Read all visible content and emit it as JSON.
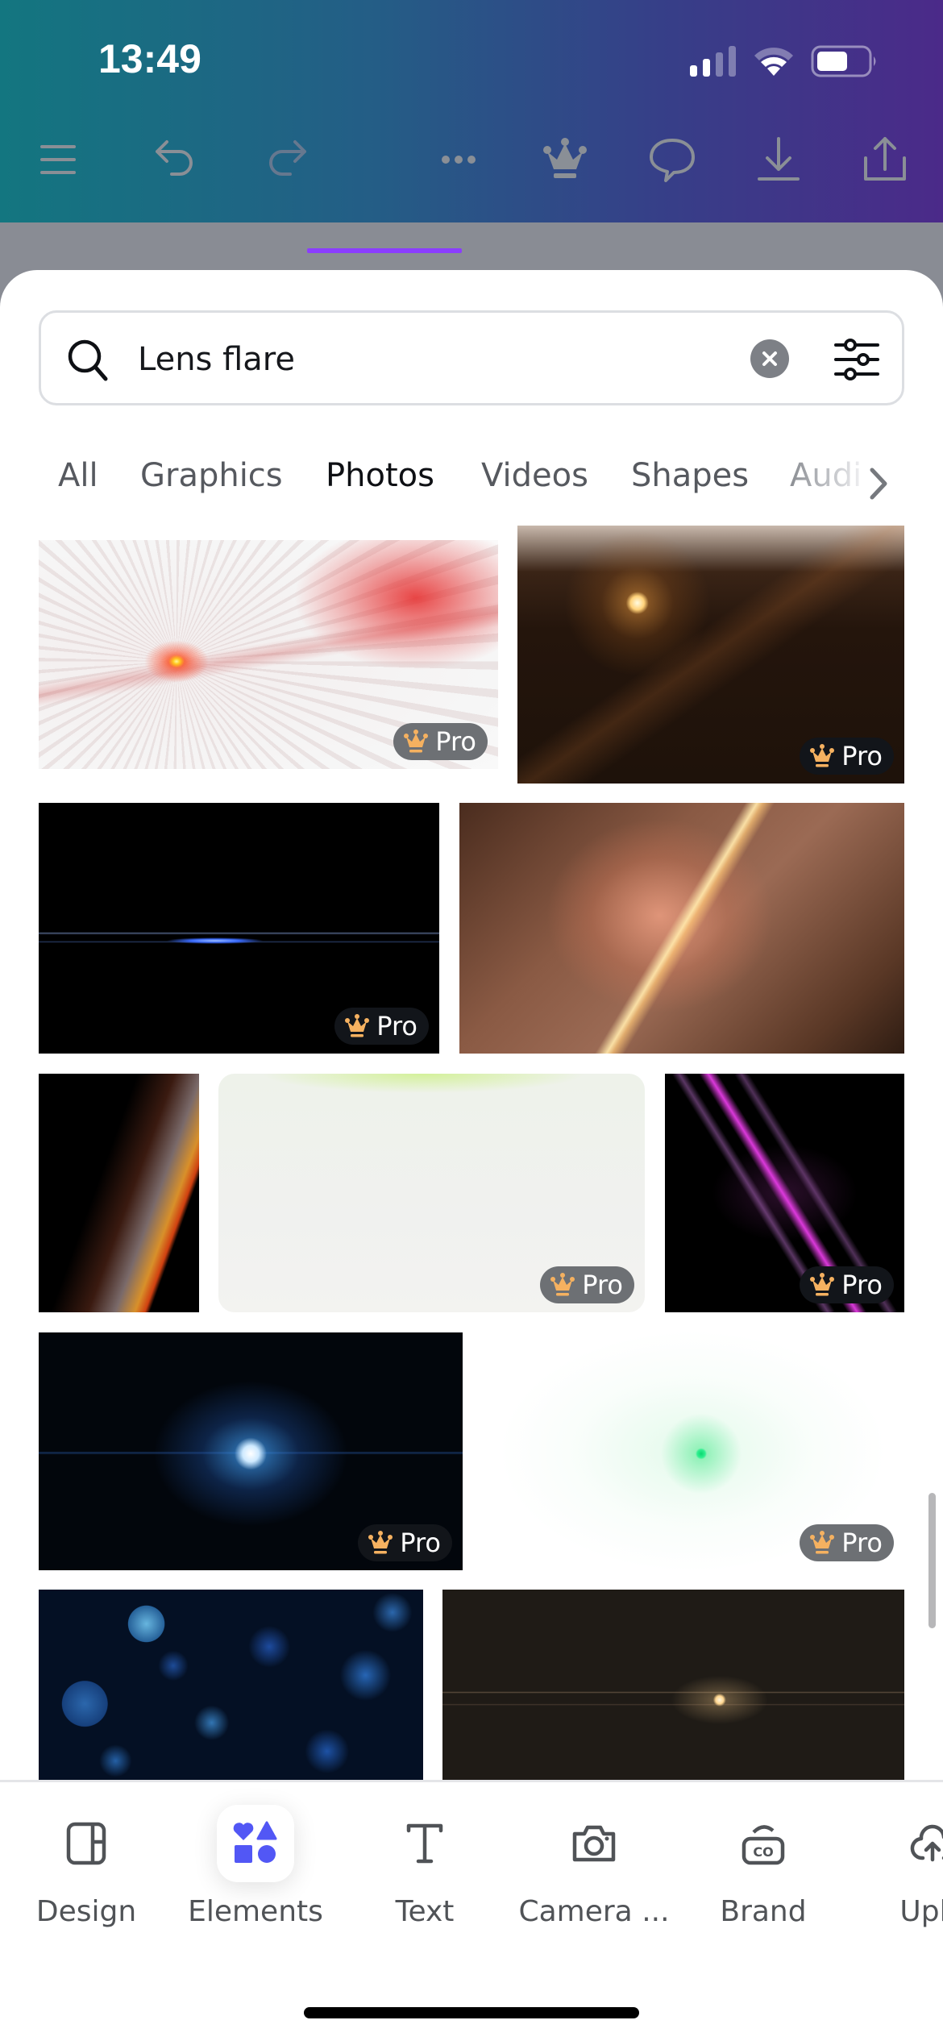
{
  "status_bar": {
    "time": "13:49",
    "icons": [
      "cellular-signal-icon",
      "wifi-icon",
      "battery-icon"
    ]
  },
  "toolbar": {
    "icons": [
      "menu-icon",
      "undo-icon",
      "redo-icon",
      "more-icon",
      "crown-icon",
      "comment-icon",
      "download-icon",
      "share-icon"
    ]
  },
  "search": {
    "value": "Lens flare",
    "icon": "search-icon",
    "clear_icon": "clear-icon",
    "filter_icon": "filter-sliders-icon"
  },
  "tabs": {
    "items": [
      {
        "label": "All",
        "active": false
      },
      {
        "label": "Graphics",
        "active": false
      },
      {
        "label": "Photos",
        "active": true
      },
      {
        "label": "Videos",
        "active": false
      },
      {
        "label": "Shapes",
        "active": false
      },
      {
        "label": "Audi",
        "active": false
      }
    ],
    "more_icon": "chevron-right-icon",
    "accent_color": "#8b3dff"
  },
  "results": {
    "badge_label": "Pro",
    "badge_icon": "crown-icon",
    "badge_icon_color": "#f5b160",
    "items": [
      {
        "description": "Red starburst lens flare on white",
        "pro": true,
        "badge_style": "light"
      },
      {
        "description": "Golden sun star lens flare on dark brown",
        "pro": true,
        "badge_style": "dark"
      },
      {
        "description": "Blue horizontal anamorphic streak on black",
        "pro": true,
        "badge_style": "dark"
      },
      {
        "description": "Warm peach diagonal light leak",
        "pro": false,
        "badge_style": ""
      },
      {
        "description": "Rainbow prism edge on black",
        "pro": false,
        "badge_style": ""
      },
      {
        "description": "Pale green-white gradient glow",
        "pro": true,
        "badge_style": "light"
      },
      {
        "description": "Purple diagonal light streaks on black",
        "pro": true,
        "badge_style": "dark"
      },
      {
        "description": "Blue glowing light orb on black",
        "pro": true,
        "badge_style": "dark"
      },
      {
        "description": "Green lens flare dot on white",
        "pro": true,
        "badge_style": "light"
      },
      {
        "description": "Blue bokeh circles",
        "pro": false,
        "badge_style": ""
      },
      {
        "description": "Small warm flare on dark background",
        "pro": false,
        "badge_style": ""
      }
    ]
  },
  "bottom_nav": {
    "items": [
      {
        "label": "Design",
        "icon": "design-layout-icon",
        "active": false
      },
      {
        "label": "Elements",
        "icon": "elements-shapes-icon",
        "active": true
      },
      {
        "label": "Text",
        "icon": "text-icon",
        "active": false
      },
      {
        "label": "Camera ...",
        "icon": "camera-icon",
        "active": false
      },
      {
        "label": "Brand",
        "icon": "brand-icon",
        "active": false
      },
      {
        "label": "Uplo",
        "icon": "upload-cloud-icon",
        "active": false
      }
    ],
    "active_color": "#5257f5"
  }
}
